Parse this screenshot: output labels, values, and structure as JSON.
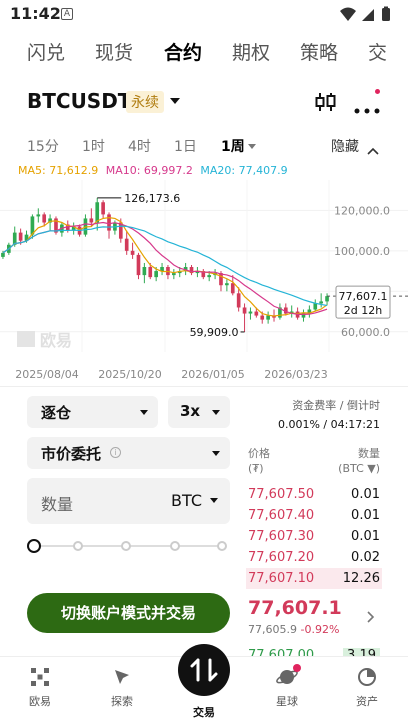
{
  "status": {
    "time": "11:42",
    "notif_glyph": "A"
  },
  "top_tabs": [
    {
      "label": "闪兑",
      "active": false
    },
    {
      "label": "现货",
      "active": false
    },
    {
      "label": "合约",
      "active": true
    },
    {
      "label": "期权",
      "active": false
    },
    {
      "label": "策略",
      "active": false
    },
    {
      "label": "交",
      "active": false
    }
  ],
  "pair": {
    "name": "BTCUSDT",
    "badge": "永续"
  },
  "intervals": [
    {
      "label": "15分"
    },
    {
      "label": "1时"
    },
    {
      "label": "4时"
    },
    {
      "label": "1日"
    },
    {
      "label": "1周",
      "active": true
    }
  ],
  "hide_label": "隐藏",
  "ma": {
    "ma5": "MA5: 71,612.9",
    "ma10": "MA10: 69,997.2",
    "ma20": "MA20: 77,407.9",
    "colors": {
      "ma5": "#e5a200",
      "ma10": "#d6398c",
      "ma20": "#25b4d6"
    }
  },
  "chart_data": {
    "type": "candlestick",
    "watermark": "欧易",
    "y_ticks": [
      "120,000.0",
      "100,000.0",
      "80,000.0",
      "60,000.0"
    ],
    "ylim": [
      50000,
      135000
    ],
    "x_ticks": [
      "2025/08/04",
      "2025/10/20",
      "2026/01/05",
      "2026/03/23"
    ],
    "high_label": "126,173.6",
    "low_label": "59,909.0",
    "current_price_label": "77,607.1",
    "countdown_label": "2d 12h",
    "candles": [
      [
        97000,
        100000,
        96000,
        99000
      ],
      [
        99000,
        104000,
        98000,
        103000
      ],
      [
        103000,
        112000,
        102000,
        109000
      ],
      [
        109000,
        111000,
        103000,
        105000
      ],
      [
        105000,
        110000,
        104000,
        108000
      ],
      [
        108000,
        118000,
        106000,
        117000
      ],
      [
        117000,
        121000,
        114000,
        118000
      ],
      [
        118000,
        119000,
        112000,
        114000
      ],
      [
        114000,
        118000,
        110000,
        116000
      ],
      [
        116000,
        117000,
        108000,
        109000
      ],
      [
        109000,
        114000,
        107000,
        113000
      ],
      [
        113000,
        115000,
        109000,
        110000
      ],
      [
        110000,
        114000,
        108000,
        112000
      ],
      [
        112000,
        113000,
        107000,
        108000
      ],
      [
        108000,
        118000,
        107000,
        116000
      ],
      [
        116000,
        121000,
        112000,
        114000
      ],
      [
        114000,
        126173.6,
        110000,
        124000
      ],
      [
        124000,
        125000,
        116000,
        118000
      ],
      [
        118000,
        119000,
        106000,
        110000
      ],
      [
        110000,
        115000,
        108000,
        114000
      ],
      [
        114000,
        116000,
        104000,
        106000
      ],
      [
        106000,
        110000,
        98000,
        100000
      ],
      [
        100000,
        104000,
        96000,
        98000
      ],
      [
        98000,
        99000,
        86000,
        88000
      ],
      [
        88000,
        94000,
        84000,
        92000
      ],
      [
        92000,
        94000,
        86000,
        87000
      ],
      [
        87000,
        92000,
        85000,
        90000
      ],
      [
        90000,
        94000,
        88000,
        92000
      ],
      [
        92000,
        93000,
        86000,
        88000
      ],
      [
        88000,
        91000,
        86000,
        89000
      ],
      [
        89000,
        92000,
        87000,
        90000
      ],
      [
        90000,
        94000,
        88000,
        92000
      ],
      [
        92000,
        93000,
        88000,
        89000
      ],
      [
        89000,
        92000,
        87000,
        90000
      ],
      [
        90000,
        91000,
        86000,
        87000
      ],
      [
        87000,
        90000,
        85000,
        88000
      ],
      [
        88000,
        91000,
        86000,
        89000
      ],
      [
        89000,
        90000,
        80000,
        83000
      ],
      [
        83000,
        86000,
        80000,
        84000
      ],
      [
        84000,
        88000,
        78000,
        79000
      ],
      [
        79000,
        82000,
        70000,
        72000
      ],
      [
        72000,
        74000,
        59909,
        69000
      ],
      [
        69000,
        72000,
        66000,
        70000
      ],
      [
        70000,
        72000,
        67000,
        68000
      ],
      [
        68000,
        70000,
        64000,
        66000
      ],
      [
        66000,
        70000,
        64000,
        68000
      ],
      [
        68000,
        71000,
        65000,
        67000
      ],
      [
        67000,
        74000,
        66000,
        72000
      ],
      [
        72000,
        74000,
        68000,
        69000
      ],
      [
        69000,
        73000,
        67000,
        70000
      ],
      [
        70000,
        72000,
        66000,
        67000
      ],
      [
        67000,
        71000,
        65000,
        69000
      ],
      [
        69000,
        73000,
        67000,
        71000
      ],
      [
        71000,
        76000,
        70000,
        74000
      ],
      [
        74000,
        79000,
        72000,
        75000
      ],
      [
        75000,
        79000,
        73000,
        77607.1
      ]
    ],
    "up_color": "#2faa52",
    "down_color": "#d23a5a"
  },
  "margin_mode": "逐仓",
  "leverage": "3x",
  "funding": {
    "label": "资金费率 / 倒计时",
    "value": "0.001% / 04:17:21"
  },
  "order_type": "市价委托",
  "order_type_info": "i",
  "qty": {
    "placeholder": "数量",
    "unit": "BTC"
  },
  "slider_value": 0,
  "trade_button": "切换账户模式并交易",
  "orderbook": {
    "price_header": "价格",
    "price_unit": "(₮)",
    "qty_header": "数量",
    "qty_unit": "(BTC ▼)",
    "asks": [
      {
        "price": "77,607.50",
        "qty": "0.01"
      },
      {
        "price": "77,607.40",
        "qty": "0.01"
      },
      {
        "price": "77,607.30",
        "qty": "0.01"
      },
      {
        "price": "77,607.20",
        "qty": "0.02"
      },
      {
        "price": "77,607.10",
        "qty": "12.26"
      }
    ],
    "last_price": "77,607.1",
    "mark_price": "77,605.9",
    "change": "-0.92%",
    "bid_peek": {
      "price": "77,607.00",
      "qty": "3.19"
    }
  },
  "nav": {
    "items": [
      {
        "label": "欧易",
        "icon": "okx-logo-icon"
      },
      {
        "label": "探索",
        "icon": "compass-icon"
      },
      {
        "label": "交易",
        "icon": "trade-swap-icon",
        "active": true
      },
      {
        "label": "星球",
        "icon": "planet-icon"
      },
      {
        "label": "资产",
        "icon": "assets-pie-icon"
      }
    ]
  }
}
